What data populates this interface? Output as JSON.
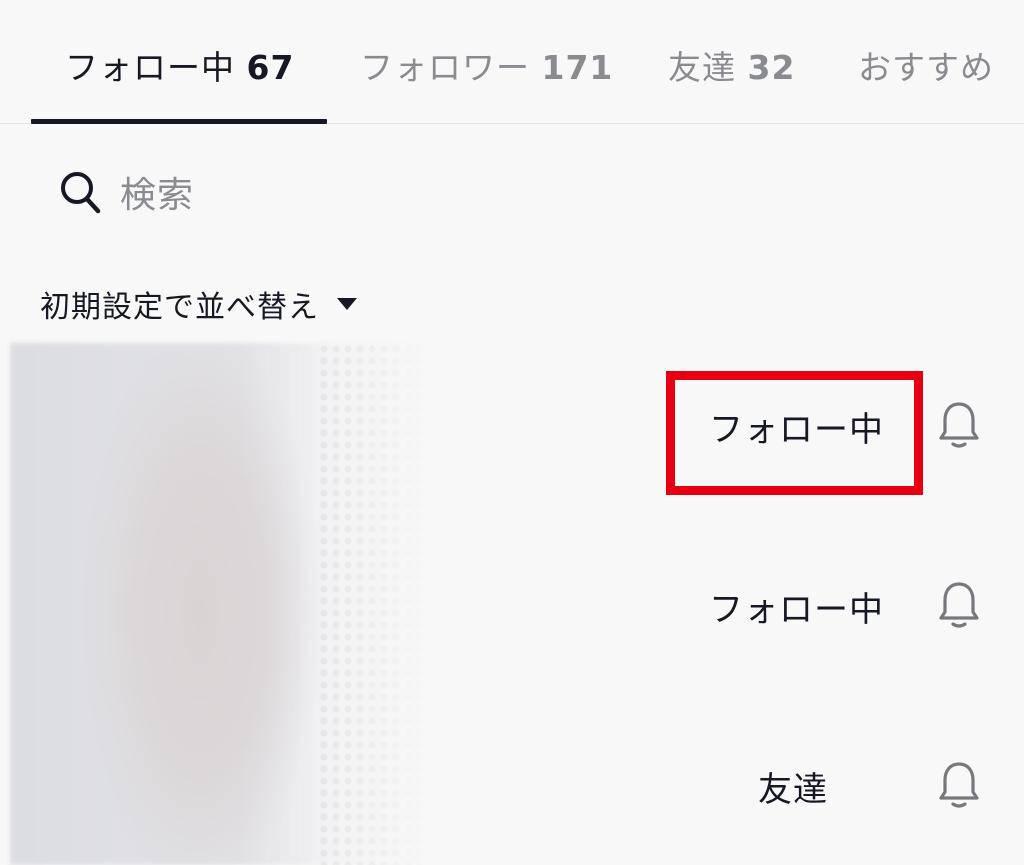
{
  "tabs": [
    {
      "label": "フォロー中",
      "count": "67",
      "active": true
    },
    {
      "label": "フォロワー",
      "count": "171",
      "active": false
    },
    {
      "label": "友達",
      "count": "32",
      "active": false
    },
    {
      "label": "おすすめ",
      "count": "",
      "active": false
    }
  ],
  "search": {
    "placeholder": "検索",
    "icon": "search-icon"
  },
  "sort": {
    "label": "初期設定で並べ替え",
    "icon": "caret-down-icon"
  },
  "users": [
    {
      "status_label": "フォロー中",
      "bell_icon": "bell-icon",
      "highlighted": true
    },
    {
      "status_label": "フォロー中",
      "bell_icon": "bell-icon",
      "highlighted": false
    },
    {
      "status_label": "友達",
      "bell_icon": "bell-icon",
      "highlighted": false
    }
  ],
  "colors": {
    "background": "#f8f8f8",
    "text_primary": "#161823",
    "text_secondary": "#8a8b91",
    "highlight_border": "#e60012"
  }
}
